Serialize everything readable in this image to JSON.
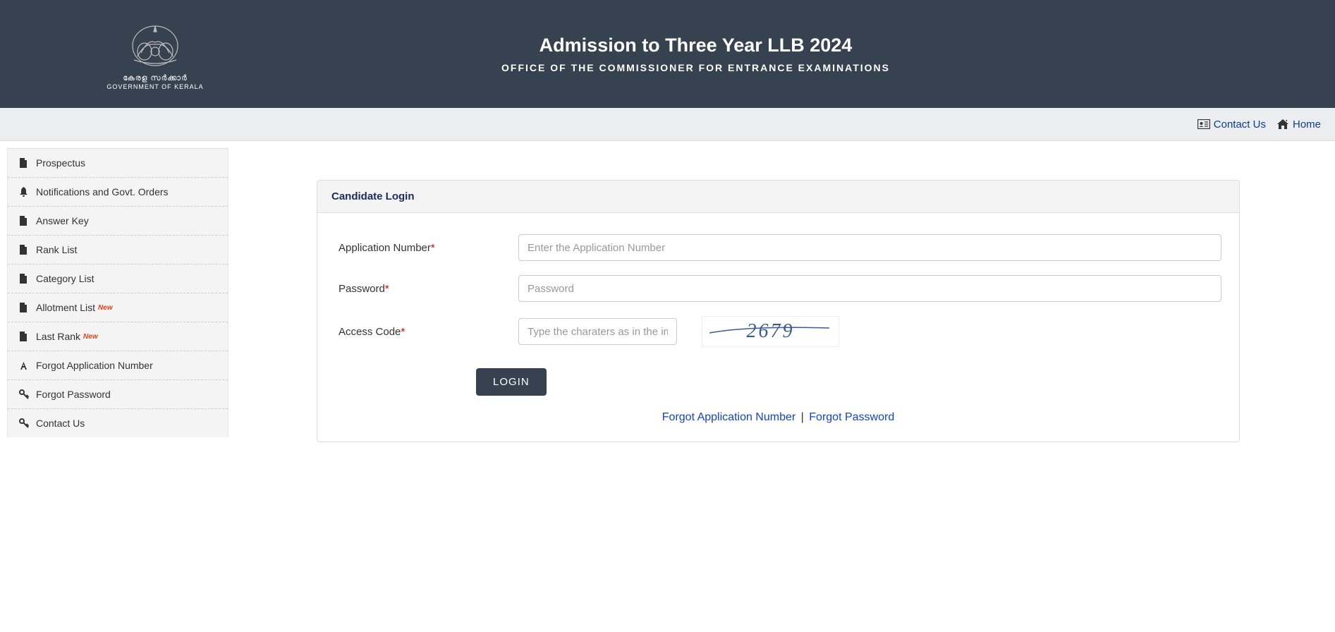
{
  "header": {
    "logo_line1": "കേരള സർക്കാർ",
    "logo_line2": "GOVERNMENT OF KERALA",
    "title": "Admission to Three Year LLB 2024",
    "subtitle": "OFFICE OF THE COMMISSIONER FOR ENTRANCE EXAMINATIONS"
  },
  "topbar": {
    "contact": "Contact Us",
    "home": "Home"
  },
  "sidebar": {
    "items": [
      {
        "label": "Prospectus",
        "icon": "pdf",
        "new": false
      },
      {
        "label": "Notifications and Govt. Orders",
        "icon": "bell",
        "new": false
      },
      {
        "label": "Answer Key",
        "icon": "pdf",
        "new": false
      },
      {
        "label": "Rank List",
        "icon": "pdf",
        "new": false
      },
      {
        "label": "Category List",
        "icon": "pdf",
        "new": false
      },
      {
        "label": "Allotment List",
        "icon": "pdf",
        "new": true
      },
      {
        "label": "Last Rank",
        "icon": "pdf",
        "new": true
      },
      {
        "label": "Forgot Application Number",
        "icon": "font",
        "new": false
      },
      {
        "label": "Forgot Password",
        "icon": "key",
        "new": false
      },
      {
        "label": "Contact Us",
        "icon": "key",
        "new": false
      }
    ],
    "new_label": "New"
  },
  "login": {
    "card_title": "Candidate Login",
    "appnum_label": "Application Number",
    "appnum_placeholder": "Enter the Application Number",
    "password_label": "Password",
    "password_placeholder": "Password",
    "access_label": "Access Code",
    "access_placeholder": "Type the charaters as in the image",
    "captcha_value": "2679",
    "login_button": "LOGIN",
    "forgot_appnum": "Forgot Application Number",
    "forgot_password": "Forgot Password",
    "separator": "|"
  }
}
